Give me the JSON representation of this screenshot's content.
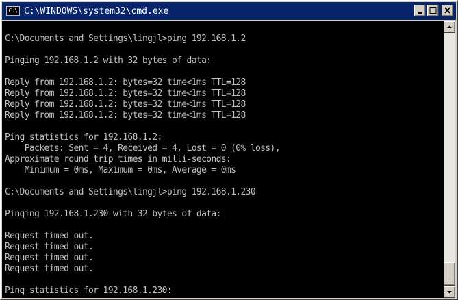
{
  "window": {
    "title": "C:\\WINDOWS\\system32\\cmd.exe",
    "icon": "cmd-icon",
    "icon_text": "C:\\"
  },
  "title_buttons": {
    "minimize_icon": "minimize-icon",
    "maximize_icon": "maximize-icon",
    "close_icon": "close-icon"
  },
  "console": {
    "lines": [
      "",
      "C:\\Documents and Settings\\lingjl>ping 192.168.1.2",
      "",
      "Pinging 192.168.1.2 with 32 bytes of data:",
      "",
      "Reply from 192.168.1.2: bytes=32 time<1ms TTL=128",
      "Reply from 192.168.1.2: bytes=32 time<1ms TTL=128",
      "Reply from 192.168.1.2: bytes=32 time<1ms TTL=128",
      "Reply from 192.168.1.2: bytes=32 time<1ms TTL=128",
      "",
      "Ping statistics for 192.168.1.2:",
      "    Packets: Sent = 4, Received = 4, Lost = 0 (0% loss),",
      "Approximate round trip times in milli-seconds:",
      "    Minimum = 0ms, Maximum = 0ms, Average = 0ms",
      "",
      "C:\\Documents and Settings\\lingjl>ping 192.168.1.230",
      "",
      "Pinging 192.168.1.230 with 32 bytes of data:",
      "",
      "Request timed out.",
      "Request timed out.",
      "Request timed out.",
      "Request timed out.",
      "",
      "Ping statistics for 192.168.1.230:"
    ]
  },
  "colors": {
    "titlebar": "#08246b",
    "console_bg": "#000000",
    "console_fg": "#c0c0c0"
  }
}
